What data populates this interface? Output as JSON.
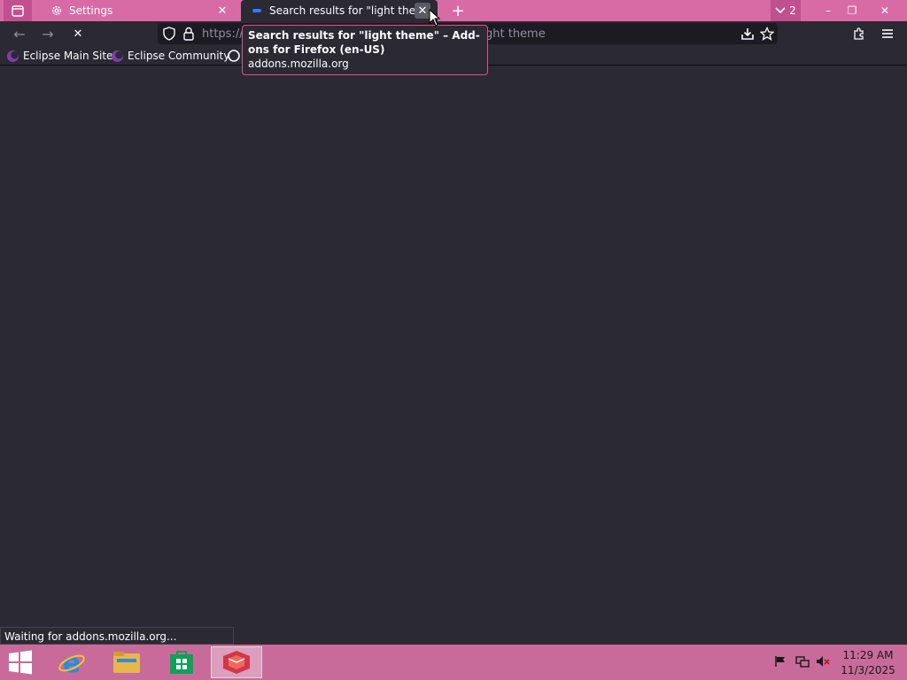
{
  "tabs": [
    {
      "title": "Settings",
      "icon": "gear-icon"
    },
    {
      "title": "Search results for \"light theme\" – Add-ons for Firefox (en-US)",
      "icon": "addons-favicon"
    }
  ],
  "tab_close_glyph": "✕",
  "new_tab_glyph": "+",
  "all_tabs_count": "2",
  "window": {
    "minimize": "–",
    "restore": "❐",
    "close": "✕"
  },
  "nav": {
    "back": "←",
    "forward": "→",
    "reload": "✕"
  },
  "urlbar": {
    "prefix": "https://",
    "suffix": "ght theme"
  },
  "bookmarks": [
    {
      "label": "Eclipse Main Site"
    },
    {
      "label": "Eclipse Community"
    }
  ],
  "tooltip": {
    "title": "Search results for \"light theme\" – Add-ons for Firefox (en-US)",
    "url": "addons.mozilla.org"
  },
  "status": "Waiting for addons.mozilla.org...",
  "clock": {
    "time": "11:29 AM",
    "date": "11/3/2025"
  },
  "colors": {
    "tabstrip": "#d86ba6",
    "taskbar": "#c86b9a",
    "content": "#2b2a33",
    "tooltip_border": "#e1508f"
  }
}
